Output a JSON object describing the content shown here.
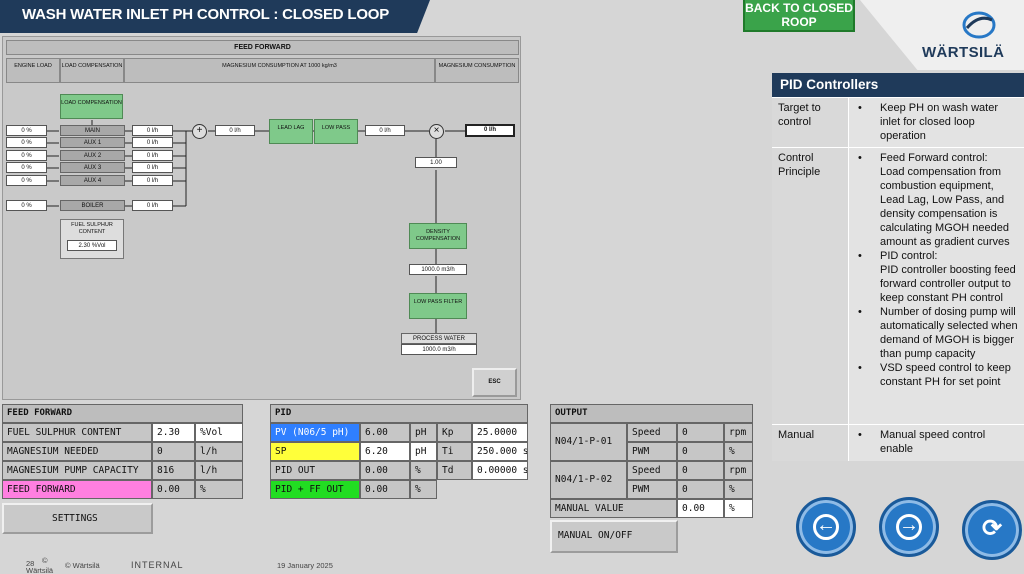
{
  "header": {
    "title": "WASH WATER INLET PH CONTROL : CLOSED LOOP",
    "back_button": "BACK TO CLOSED ROOP",
    "logo_text": "WÄRTSILÄ"
  },
  "feed_forward_panel": {
    "title": "FEED FORWARD",
    "columns": [
      "ENGINE LOAD",
      "LOAD COMPENSATION",
      "MAGNESIUM CONSUMPTION AT 1000 kg/m3",
      "MAGNESIUM CONSUMPTION"
    ],
    "load_comp_button": "LOAD COMPENSATION",
    "engines": [
      {
        "load": "0 %",
        "name": "MAIN",
        "flow": "0 l/h"
      },
      {
        "load": "0 %",
        "name": "AUX 1",
        "flow": "0 l/h"
      },
      {
        "load": "0 %",
        "name": "AUX 2",
        "flow": "0 l/h"
      },
      {
        "load": "0 %",
        "name": "AUX 3",
        "flow": "0 l/h"
      },
      {
        "load": "0 %",
        "name": "AUX 4",
        "flow": "0 l/h"
      }
    ],
    "boiler": {
      "load": "0 %",
      "name": "BOILER",
      "flow": "0 l/h"
    },
    "fuel_sulphur": {
      "label": "FUEL SULPHUR CONTENT",
      "value": "2.30 %Vol"
    },
    "sum_symbol": "+",
    "sum_value": "0 l/h",
    "lead_lag": "LEAD LAG",
    "low_pass": "LOW PASS",
    "after_lowpass": "0 l/h",
    "mult_symbol": "×",
    "output_value": "0 l/h",
    "factor": "1.00",
    "density_comp": "DENSITY COMPENSATION",
    "density_value": "1000.0 m3/h",
    "low_pass_filter": "LOW PASS FILTER",
    "process_water_label": "PROCESS WATER",
    "process_water_value": "1000.0 m3/h",
    "esc": "ESC"
  },
  "feed_forward_table": {
    "title": "FEED FORWARD",
    "rows": [
      {
        "label": "FUEL SULPHUR CONTENT",
        "value": "2.30",
        "unit": "%Vol"
      },
      {
        "label": "MAGNESIUM NEEDED",
        "value": "0",
        "unit": "l/h"
      },
      {
        "label": "MAGNESIUM PUMP CAPACITY",
        "value": "816",
        "unit": "l/h"
      },
      {
        "label": "FEED FORWARD",
        "value": "0.00",
        "unit": "%"
      }
    ],
    "settings_button": "SETTINGS"
  },
  "pid_table": {
    "title": "PID",
    "rows": [
      {
        "label": "PV (N06/5 pH)",
        "value": "6.00",
        "unit": "pH",
        "param": "Kp",
        "param_value": "25.0000"
      },
      {
        "label": "SP",
        "value": "6.20",
        "unit": "pH",
        "param": "Ti",
        "param_value": "250.000 s"
      },
      {
        "label": "PID OUT",
        "value": "0.00",
        "unit": "%",
        "param": "Td",
        "param_value": "0.00000 s"
      },
      {
        "label": "PID + FF OUT",
        "value": "0.00",
        "unit": "%"
      }
    ]
  },
  "output_table": {
    "title": "OUTPUT",
    "pumps": [
      {
        "name": "N04/1-P-01",
        "speed_label": "Speed",
        "speed_value": "0",
        "speed_unit": "rpm",
        "pwm_label": "PWM",
        "pwm_value": "0",
        "pwm_unit": "%"
      },
      {
        "name": "N04/1-P-02",
        "speed_label": "Speed",
        "speed_value": "0",
        "speed_unit": "rpm",
        "pwm_label": "PWM",
        "pwm_value": "0",
        "pwm_unit": "%"
      }
    ],
    "manual_value_label": "MANUAL VALUE",
    "manual_value": "0.00",
    "manual_unit": "%",
    "manual_onoff": "MANUAL ON/OFF"
  },
  "pid_controllers": {
    "title": "PID Controllers",
    "target_label": "Target to control",
    "target_text": "Keep PH on wash water inlet for closed loop operation",
    "principle_label": "Control Principle",
    "principle_1_head": "Feed Forward control:",
    "principle_1_body": "Load compensation from combustion equipment, Lead Lag, Low Pass, and density compensation is calculating MGOH needed amount as gradient curves",
    "principle_2_head": "PID control:",
    "principle_2_body": "PID controller boosting feed forward controller output to keep constant PH control",
    "principle_3": "Number of dosing pump will automatically selected when demand of MGOH is bigger than pump capacity",
    "principle_4": "VSD speed control to keep constant PH for set point",
    "manual_label": "Manual",
    "manual_text": "Manual speed control enable"
  },
  "footer": {
    "page": "28",
    "copyright_symbol": "©",
    "company": "Wärtsilä",
    "copyright": "© Wärtsilä",
    "classification": "INTERNAL",
    "date": "19 January 2025"
  },
  "colors": {
    "title_bg": "#1f3a5a",
    "green_box": "#7fc98a",
    "nav_blue": "#2778c6",
    "pink": "#ff7fe0",
    "pv_blue": "#2f7fff",
    "sp_yellow": "#ffff3a",
    "pidff_green": "#22dd22"
  }
}
